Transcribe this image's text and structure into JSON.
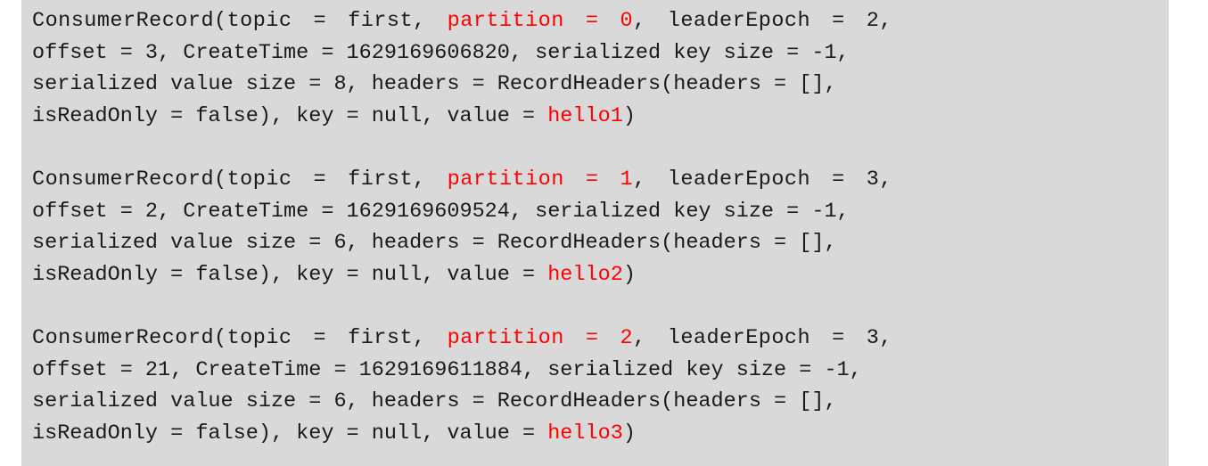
{
  "console": {
    "background_color": "#d9d9d9",
    "text_color": "#1a1a1a",
    "highlight_color": "#ff0000",
    "records": [
      {
        "lines": [
          {
            "segments": [
              {
                "text": "ConsumerRecord(topic = first, ",
                "highlight": false
              },
              {
                "text": "partition = 0",
                "highlight": true
              },
              {
                "text": ", leaderEpoch = 2,",
                "highlight": false
              }
            ]
          },
          {
            "segments": [
              {
                "text": "offset = 3, CreateTime = 1629169606820, serialized key size = -1,",
                "highlight": false
              }
            ]
          },
          {
            "segments": [
              {
                "text": "serialized value size = 8, headers = RecordHeaders(headers = [],",
                "highlight": false
              }
            ]
          },
          {
            "segments": [
              {
                "text": "isReadOnly = false), key = null, value = ",
                "highlight": false
              },
              {
                "text": "hello1",
                "highlight": true
              },
              {
                "text": ")",
                "highlight": false
              }
            ]
          }
        ]
      },
      {
        "lines": [
          {
            "segments": [
              {
                "text": "ConsumerRecord(topic = first, ",
                "highlight": false
              },
              {
                "text": "partition = 1",
                "highlight": true
              },
              {
                "text": ", leaderEpoch = 3,",
                "highlight": false
              }
            ]
          },
          {
            "segments": [
              {
                "text": "offset = 2, CreateTime = 1629169609524, serialized key size = -1,",
                "highlight": false
              }
            ]
          },
          {
            "segments": [
              {
                "text": "serialized value size = 6, headers = RecordHeaders(headers = [],",
                "highlight": false
              }
            ]
          },
          {
            "segments": [
              {
                "text": "isReadOnly = false), key = null, value = ",
                "highlight": false
              },
              {
                "text": "hello2",
                "highlight": true
              },
              {
                "text": ")",
                "highlight": false
              }
            ]
          }
        ]
      },
      {
        "lines": [
          {
            "segments": [
              {
                "text": "ConsumerRecord(topic = first, ",
                "highlight": false
              },
              {
                "text": "partition = 2",
                "highlight": true
              },
              {
                "text": ", leaderEpoch = 3,",
                "highlight": false
              }
            ]
          },
          {
            "segments": [
              {
                "text": "offset = 21, CreateTime = 1629169611884, serialized key size = -1,",
                "highlight": false
              }
            ]
          },
          {
            "segments": [
              {
                "text": "serialized value size = 6, headers = RecordHeaders(headers = [],",
                "highlight": false
              }
            ]
          },
          {
            "segments": [
              {
                "text": "isReadOnly = false), key = null, value = ",
                "highlight": false
              },
              {
                "text": "hello3",
                "highlight": true
              },
              {
                "text": ")",
                "highlight": false
              }
            ]
          }
        ]
      }
    ]
  }
}
